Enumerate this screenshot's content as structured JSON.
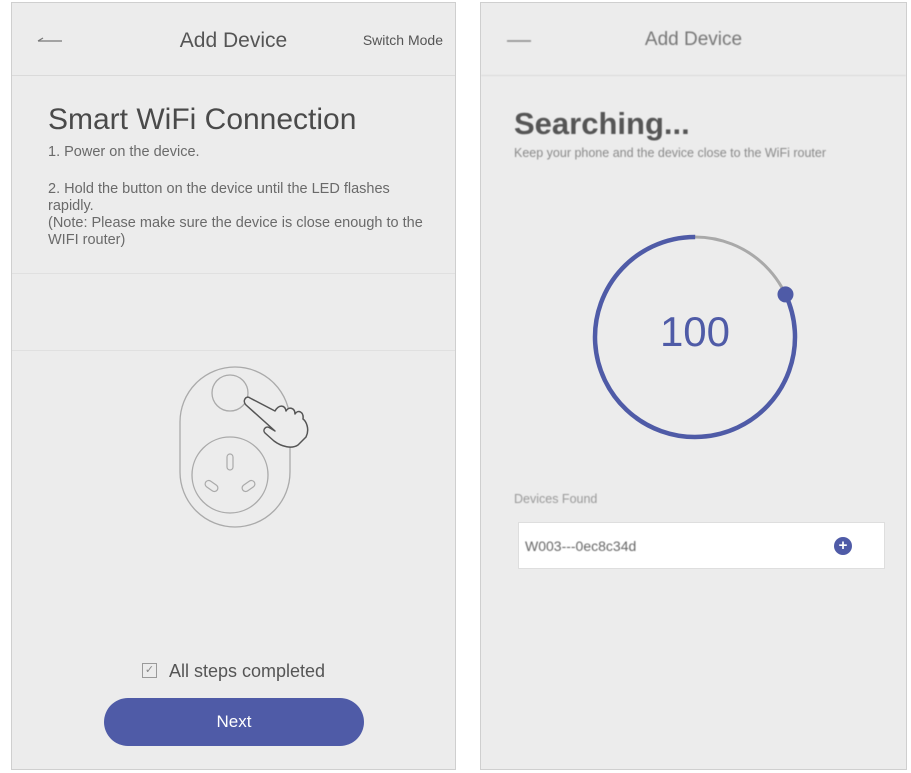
{
  "left": {
    "header": {
      "title": "Add Device",
      "switch_mode_label": "Switch Mode"
    },
    "title": "Smart WiFi Connection",
    "steps": [
      "1. Power on the device.",
      "2. Hold the button on the device until the LED flashes rapidly.\n(Note: Please make sure the device is close enough to the WIFI router)"
    ],
    "checkbox_label": "All steps completed",
    "checkbox_checked": true,
    "next_label": "Next"
  },
  "right": {
    "header": {
      "title": "Add Device"
    },
    "title": "Searching...",
    "subtitle": "Keep your phone and the device close to the WiFi router",
    "progress_value": "100",
    "progress_fraction": 0.82,
    "devices_found_label": "Devices Found",
    "devices": [
      {
        "name": "W003---0ec8c34d"
      }
    ]
  },
  "colors": {
    "accent": "#4f5ba7",
    "background": "#ececec"
  },
  "icons": [
    "back-arrow-icon",
    "checkbox-icon",
    "add-device-plus-icon",
    "smart-plug-illustration",
    "hand-pointer-icon"
  ]
}
